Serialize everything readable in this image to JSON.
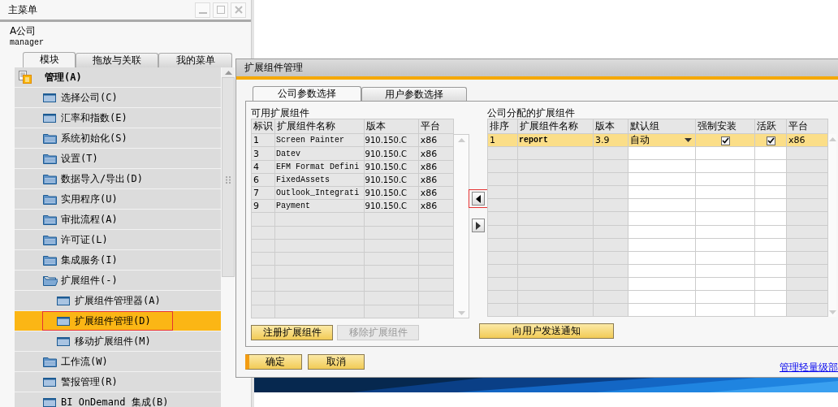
{
  "main_menu": {
    "title": "主菜单",
    "company": "A公司",
    "user": "manager",
    "tabs": [
      {
        "label": "模块",
        "selected": true
      },
      {
        "label": "拖放与关联",
        "selected": false
      },
      {
        "label": "我的菜单",
        "selected": false
      }
    ],
    "tree": [
      {
        "label": "管理(A)",
        "kind": "module",
        "selected": false,
        "highlighted": false,
        "children": [
          {
            "label": "选择公司(C)",
            "kind": "form",
            "selected": false,
            "highlighted": false
          },
          {
            "label": "汇率和指数(E)",
            "kind": "form",
            "selected": false,
            "highlighted": false
          },
          {
            "label": "系统初始化(S)",
            "kind": "folder",
            "expanded": false,
            "selected": false,
            "highlighted": false
          },
          {
            "label": "设置(T)",
            "kind": "folder",
            "expanded": false,
            "selected": false,
            "highlighted": false
          },
          {
            "label": "数据导入/导出(D)",
            "kind": "folder",
            "expanded": false,
            "selected": false,
            "highlighted": false
          },
          {
            "label": "实用程序(U)",
            "kind": "folder",
            "expanded": false,
            "selected": false,
            "highlighted": false
          },
          {
            "label": "审批流程(A)",
            "kind": "folder",
            "expanded": false,
            "selected": false,
            "highlighted": false
          },
          {
            "label": "许可证(L)",
            "kind": "folder",
            "expanded": false,
            "selected": false,
            "highlighted": false
          },
          {
            "label": "集成服务(I)",
            "kind": "folder",
            "expanded": false,
            "selected": false,
            "highlighted": false
          },
          {
            "label": "扩展组件(-)",
            "kind": "folder",
            "expanded": true,
            "selected": false,
            "highlighted": false,
            "children": [
              {
                "label": "扩展组件管理器(A)",
                "kind": "form",
                "selected": false,
                "highlighted": false
              },
              {
                "label": "扩展组件管理(D)",
                "kind": "form",
                "selected": true,
                "highlighted": true
              },
              {
                "label": "移动扩展组件(M)",
                "kind": "form",
                "selected": false,
                "highlighted": false
              }
            ]
          },
          {
            "label": "工作流(W)",
            "kind": "folder",
            "expanded": false,
            "selected": false,
            "highlighted": false
          },
          {
            "label": "警报管理(R)",
            "kind": "form",
            "selected": false,
            "highlighted": false
          },
          {
            "label": "BI OnDemand 集成(B)",
            "kind": "form",
            "selected": false,
            "highlighted": false
          }
        ]
      }
    ]
  },
  "dialog": {
    "title": "扩展组件管理",
    "tabs": [
      {
        "label": "公司参数选择",
        "selected": true
      },
      {
        "label": "用户参数选择",
        "selected": false
      }
    ],
    "available": {
      "label": "可用扩展组件",
      "columns": [
        "标识",
        "扩展组件名称",
        "版本",
        "平台"
      ],
      "rows": [
        [
          "1",
          "Screen Painter",
          "910.150.C",
          "x86"
        ],
        [
          "3",
          "Datev",
          "910.150.C",
          "x86"
        ],
        [
          "4",
          "EFM Format Defini",
          "910.150.C",
          "x86"
        ],
        [
          "6",
          "FixedAssets",
          "910.150.C",
          "x86"
        ],
        [
          "7",
          "Outlook_Integrati",
          "910.150.C",
          "x86"
        ],
        [
          "9",
          "Payment",
          "910.150.C",
          "x86"
        ]
      ]
    },
    "arrow_buttons": [
      {
        "kind": "left",
        "highlighted": true
      },
      {
        "kind": "right",
        "highlighted": false
      }
    ],
    "assigned": {
      "label": "公司分配的扩展组件",
      "columns": [
        "排序",
        "扩展组件名称",
        "版本",
        "默认组",
        "强制安装",
        "活跃",
        "平台"
      ],
      "rows": [
        {
          "order": "1",
          "name": "report",
          "version": "3.9",
          "default_group": "自动",
          "force_install": true,
          "active": true,
          "platform": "x86",
          "selected": true
        }
      ]
    },
    "left_buttons": [
      {
        "label": "注册扩展组件",
        "disabled": false
      },
      {
        "label": "移除扩展组件",
        "disabled": true
      }
    ],
    "notify_button": {
      "label": "向用户发送通知",
      "disabled": false
    },
    "footer_buttons": [
      {
        "label": "确定",
        "kind": "primary"
      },
      {
        "label": "取消",
        "kind": "normal"
      }
    ],
    "link": "管理轻量级部"
  }
}
